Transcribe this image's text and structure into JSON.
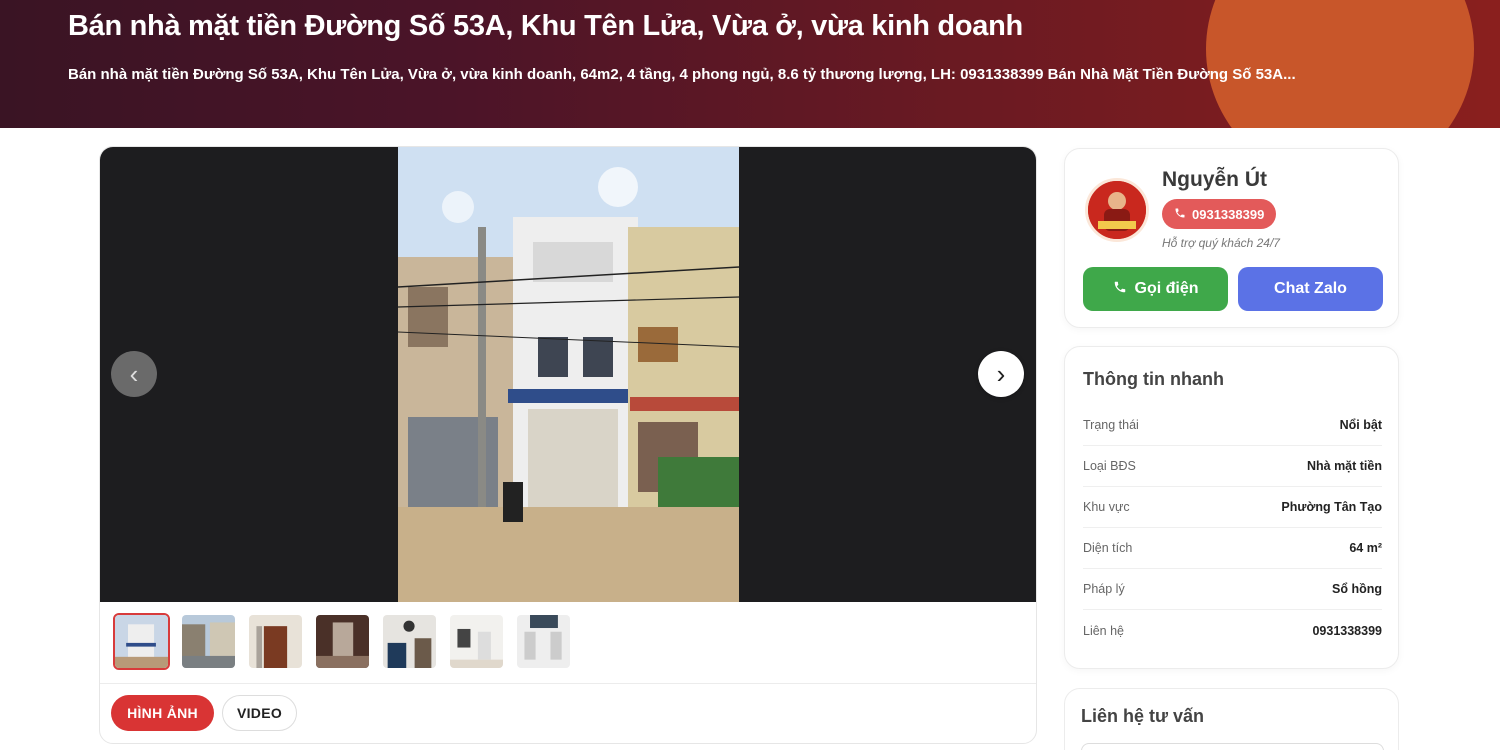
{
  "header": {
    "title": "Bán nhà mặt tiền Đường Số 53A, Khu Tên Lửa, Vừa ở, vừa kinh doanh",
    "summary": "Bán nhà mặt tiền Đường Số 53A, Khu Tên Lửa, Vừa ở, vừa kinh doanh, 64m2, 4 tầng, 4 phong ngủ, 8.6 tỷ thương lượng, LH: 0931338399 Bán Nhà Mặt Tiền Đường Số 53A..."
  },
  "gallery": {
    "prev_label": "‹",
    "next_label": "›",
    "thumbnail_count": 7,
    "active_thumbnail": 1,
    "tabs": [
      {
        "label": "HÌNH ẢNH",
        "active": true
      },
      {
        "label": "VIDEO",
        "active": false
      }
    ]
  },
  "agent": {
    "name": "Nguyễn Út",
    "phone": "0931338399",
    "support_text": "Hỗ trợ quý khách 24/7",
    "call_label": "Gọi điện",
    "zalo_label": "Chat Zalo",
    "call_icon": "phone-icon"
  },
  "quick_info": {
    "title": "Thông tin nhanh",
    "rows": [
      {
        "key": "Trạng thái",
        "value": "Nổi bật"
      },
      {
        "key": "Loại BĐS",
        "value": "Nhà mặt tiền"
      },
      {
        "key": "Khu vực",
        "value": "Phường Tân Tạo"
      },
      {
        "key": "Diện tích",
        "value": "64 m²"
      },
      {
        "key": "Pháp lý",
        "value": "Sổ hồng"
      },
      {
        "key": "Liên hệ",
        "value": "0931338399"
      }
    ]
  },
  "contact": {
    "title": "Liên hệ tư vấn"
  },
  "colors": {
    "accent_red": "#d93434",
    "call_green": "#3fa84a",
    "zalo_blue": "#5b72e6",
    "banner_orange": "#c8562a"
  }
}
